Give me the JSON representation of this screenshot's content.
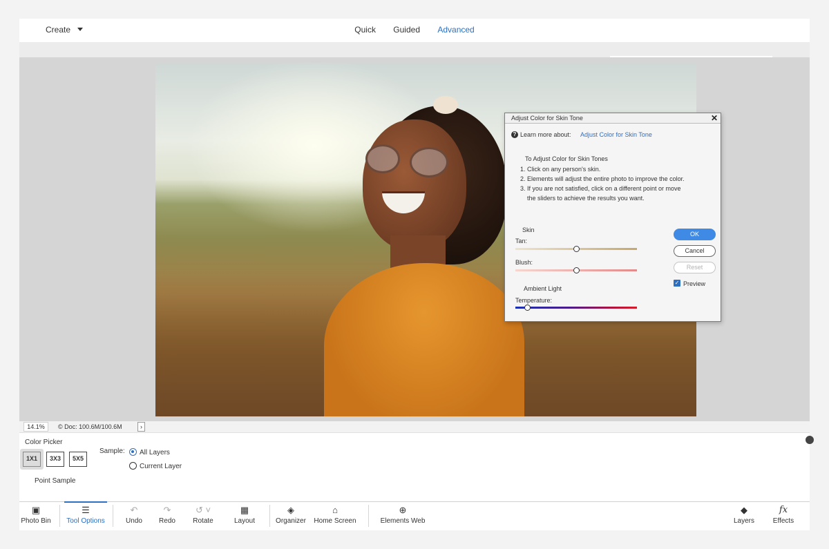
{
  "topbar": {
    "create_label": "Create",
    "modes": [
      "Quick",
      "Guided",
      "Advanced"
    ],
    "active_mode": "Advanced"
  },
  "status": {
    "zoom": "14.1%",
    "doc_info": "© Doc: 100.6M/100.6M",
    "arrow": "›"
  },
  "tool_options": {
    "title": "Color Picker",
    "sample_sizes": [
      "1X1",
      "3X3",
      "5X5"
    ],
    "selected_size": "1X1",
    "sample_caption": "Point Sample",
    "sample_label": "Sample:",
    "sample_options": [
      "All Layers",
      "Current Layer"
    ],
    "selected_sample": "All Layers"
  },
  "toolbar": {
    "items": [
      {
        "label": "Photo Bin",
        "icon": "photo-bin-icon"
      },
      {
        "label": "Tool Options",
        "icon": "tool-options-icon"
      },
      {
        "label": "Undo",
        "icon": "undo-icon"
      },
      {
        "label": "Redo",
        "icon": "redo-icon"
      },
      {
        "label": "Rotate",
        "icon": "rotate-icon"
      },
      {
        "label": "Layout",
        "icon": "layout-icon"
      },
      {
        "label": "Organizer",
        "icon": "organizer-icon"
      },
      {
        "label": "Home Screen",
        "icon": "home-icon"
      },
      {
        "label": "Elements Web",
        "icon": "globe-icon"
      },
      {
        "label": "Layers",
        "icon": "layers-icon"
      },
      {
        "label": "Effects",
        "icon": "fx-icon"
      }
    ],
    "active": "Tool Options"
  },
  "dialog": {
    "title": "Adjust Color for Skin Tone",
    "learn_more": "Learn more about:",
    "learn_link": "Adjust Color for Skin Tone",
    "instructions_title": "To Adjust Color for Skin Tones",
    "steps": [
      "1. Click on any person's skin.",
      "2. Elements will adjust the entire photo to improve the color.",
      "3. If you are not satisfied, click on a different point or move",
      "the sliders to achieve the results you want."
    ],
    "skin_section": "Skin",
    "tan_label": "Tan:",
    "blush_label": "Blush:",
    "ambient_section": "Ambient Light",
    "temperature_label": "Temperature:",
    "tan_value": 0.5,
    "blush_value": 0.5,
    "temperature_value": 0.1,
    "ok_label": "OK",
    "cancel_label": "Cancel",
    "reset_label": "Reset",
    "preview_label": "Preview",
    "preview_checked": true,
    "colors": {
      "tan_track": "#c7a76a",
      "blush_track": "#e38a8a",
      "accent": "#3e8ae4",
      "link": "#2d6fc0"
    }
  }
}
